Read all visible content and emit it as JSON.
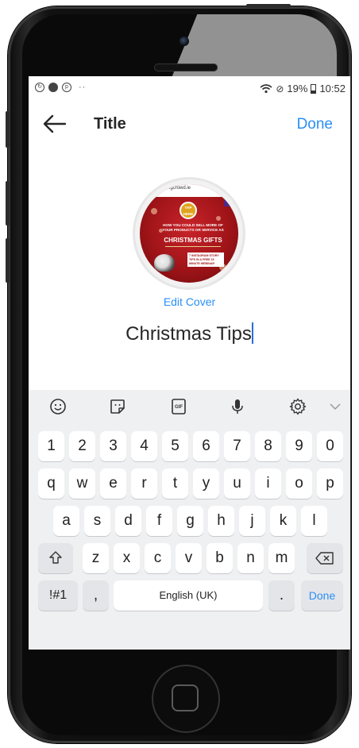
{
  "status_bar": {
    "left_icons": [
      "sync-icon",
      "instagram-icon",
      "pinterest-icon"
    ],
    "dots": "··",
    "battery_percent": "19%",
    "time": "10:52"
  },
  "appbar": {
    "title": "Title",
    "done_label": "Done"
  },
  "cover": {
    "site": "...ngcrowd.ie",
    "logo": "TAP HERE",
    "headline": "HOW YOU COULD SELL MORE OF YOUR PRODUCTS OR SERVICE AS",
    "big": "CHRISTMAS GIFTS",
    "box": "7 INSTAGRAM STORY TIPS IN A FREE 15 MINUTE WEBINAR"
  },
  "edit_cover_label": "Edit Cover",
  "title_value": "Christmas Tips",
  "keyboard": {
    "toolbar": [
      "smiley-icon",
      "sticker-icon",
      "gif-icon",
      "mic-icon",
      "gear-icon",
      "chevron-down-icon"
    ],
    "rows": [
      [
        "1",
        "2",
        "3",
        "4",
        "5",
        "6",
        "7",
        "8",
        "9",
        "0"
      ],
      [
        "q",
        "w",
        "e",
        "r",
        "t",
        "y",
        "u",
        "i",
        "o",
        "p"
      ],
      [
        "a",
        "s",
        "d",
        "f",
        "g",
        "h",
        "j",
        "k",
        "l"
      ],
      [
        "z",
        "x",
        "c",
        "v",
        "b",
        "n",
        "m"
      ]
    ],
    "symbols_label": "!#1",
    "comma": ",",
    "space_label": "English (UK)",
    "period": ".",
    "done_label": "Done"
  }
}
